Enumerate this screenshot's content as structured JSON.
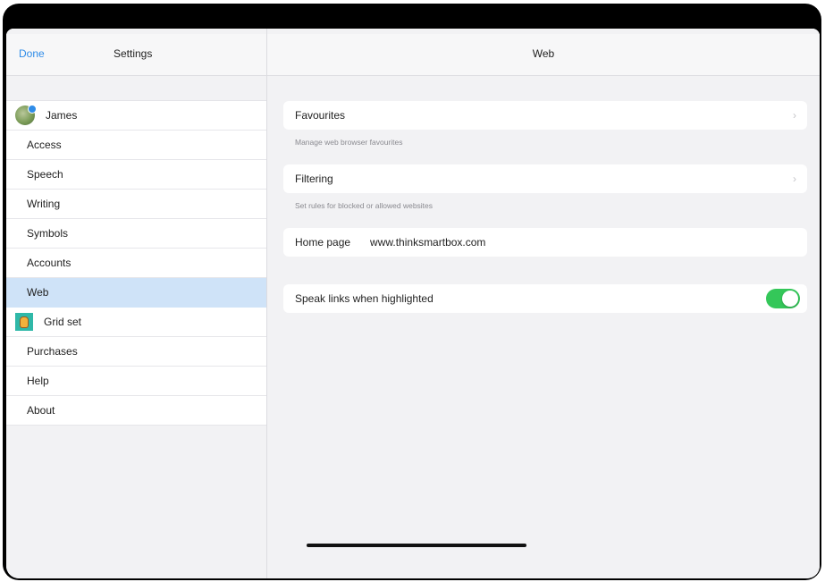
{
  "sidebar": {
    "done_label": "Done",
    "title": "Settings",
    "items": [
      {
        "label": "James",
        "icon": "user-avatar-icon"
      },
      {
        "label": "Access"
      },
      {
        "label": "Speech"
      },
      {
        "label": "Writing"
      },
      {
        "label": "Symbols"
      },
      {
        "label": "Accounts"
      },
      {
        "label": "Web",
        "selected": true
      },
      {
        "label": "Grid set",
        "icon": "grid-set-icon"
      },
      {
        "label": "Purchases"
      },
      {
        "label": "Help"
      },
      {
        "label": "About"
      }
    ]
  },
  "detail": {
    "title": "Web",
    "favourites": {
      "label": "Favourites",
      "caption": "Manage web browser favourites"
    },
    "filtering": {
      "label": "Filtering",
      "caption": "Set rules for blocked or allowed websites"
    },
    "home_page": {
      "label": "Home page",
      "value": "www.thinksmartbox.com"
    },
    "speak_links": {
      "label": "Speak links when highlighted",
      "enabled": true
    }
  },
  "colors": {
    "accent": "#2f8ce8",
    "selected_row": "#cfe3f8",
    "toggle_on": "#34c759",
    "background": "#f2f2f4"
  }
}
